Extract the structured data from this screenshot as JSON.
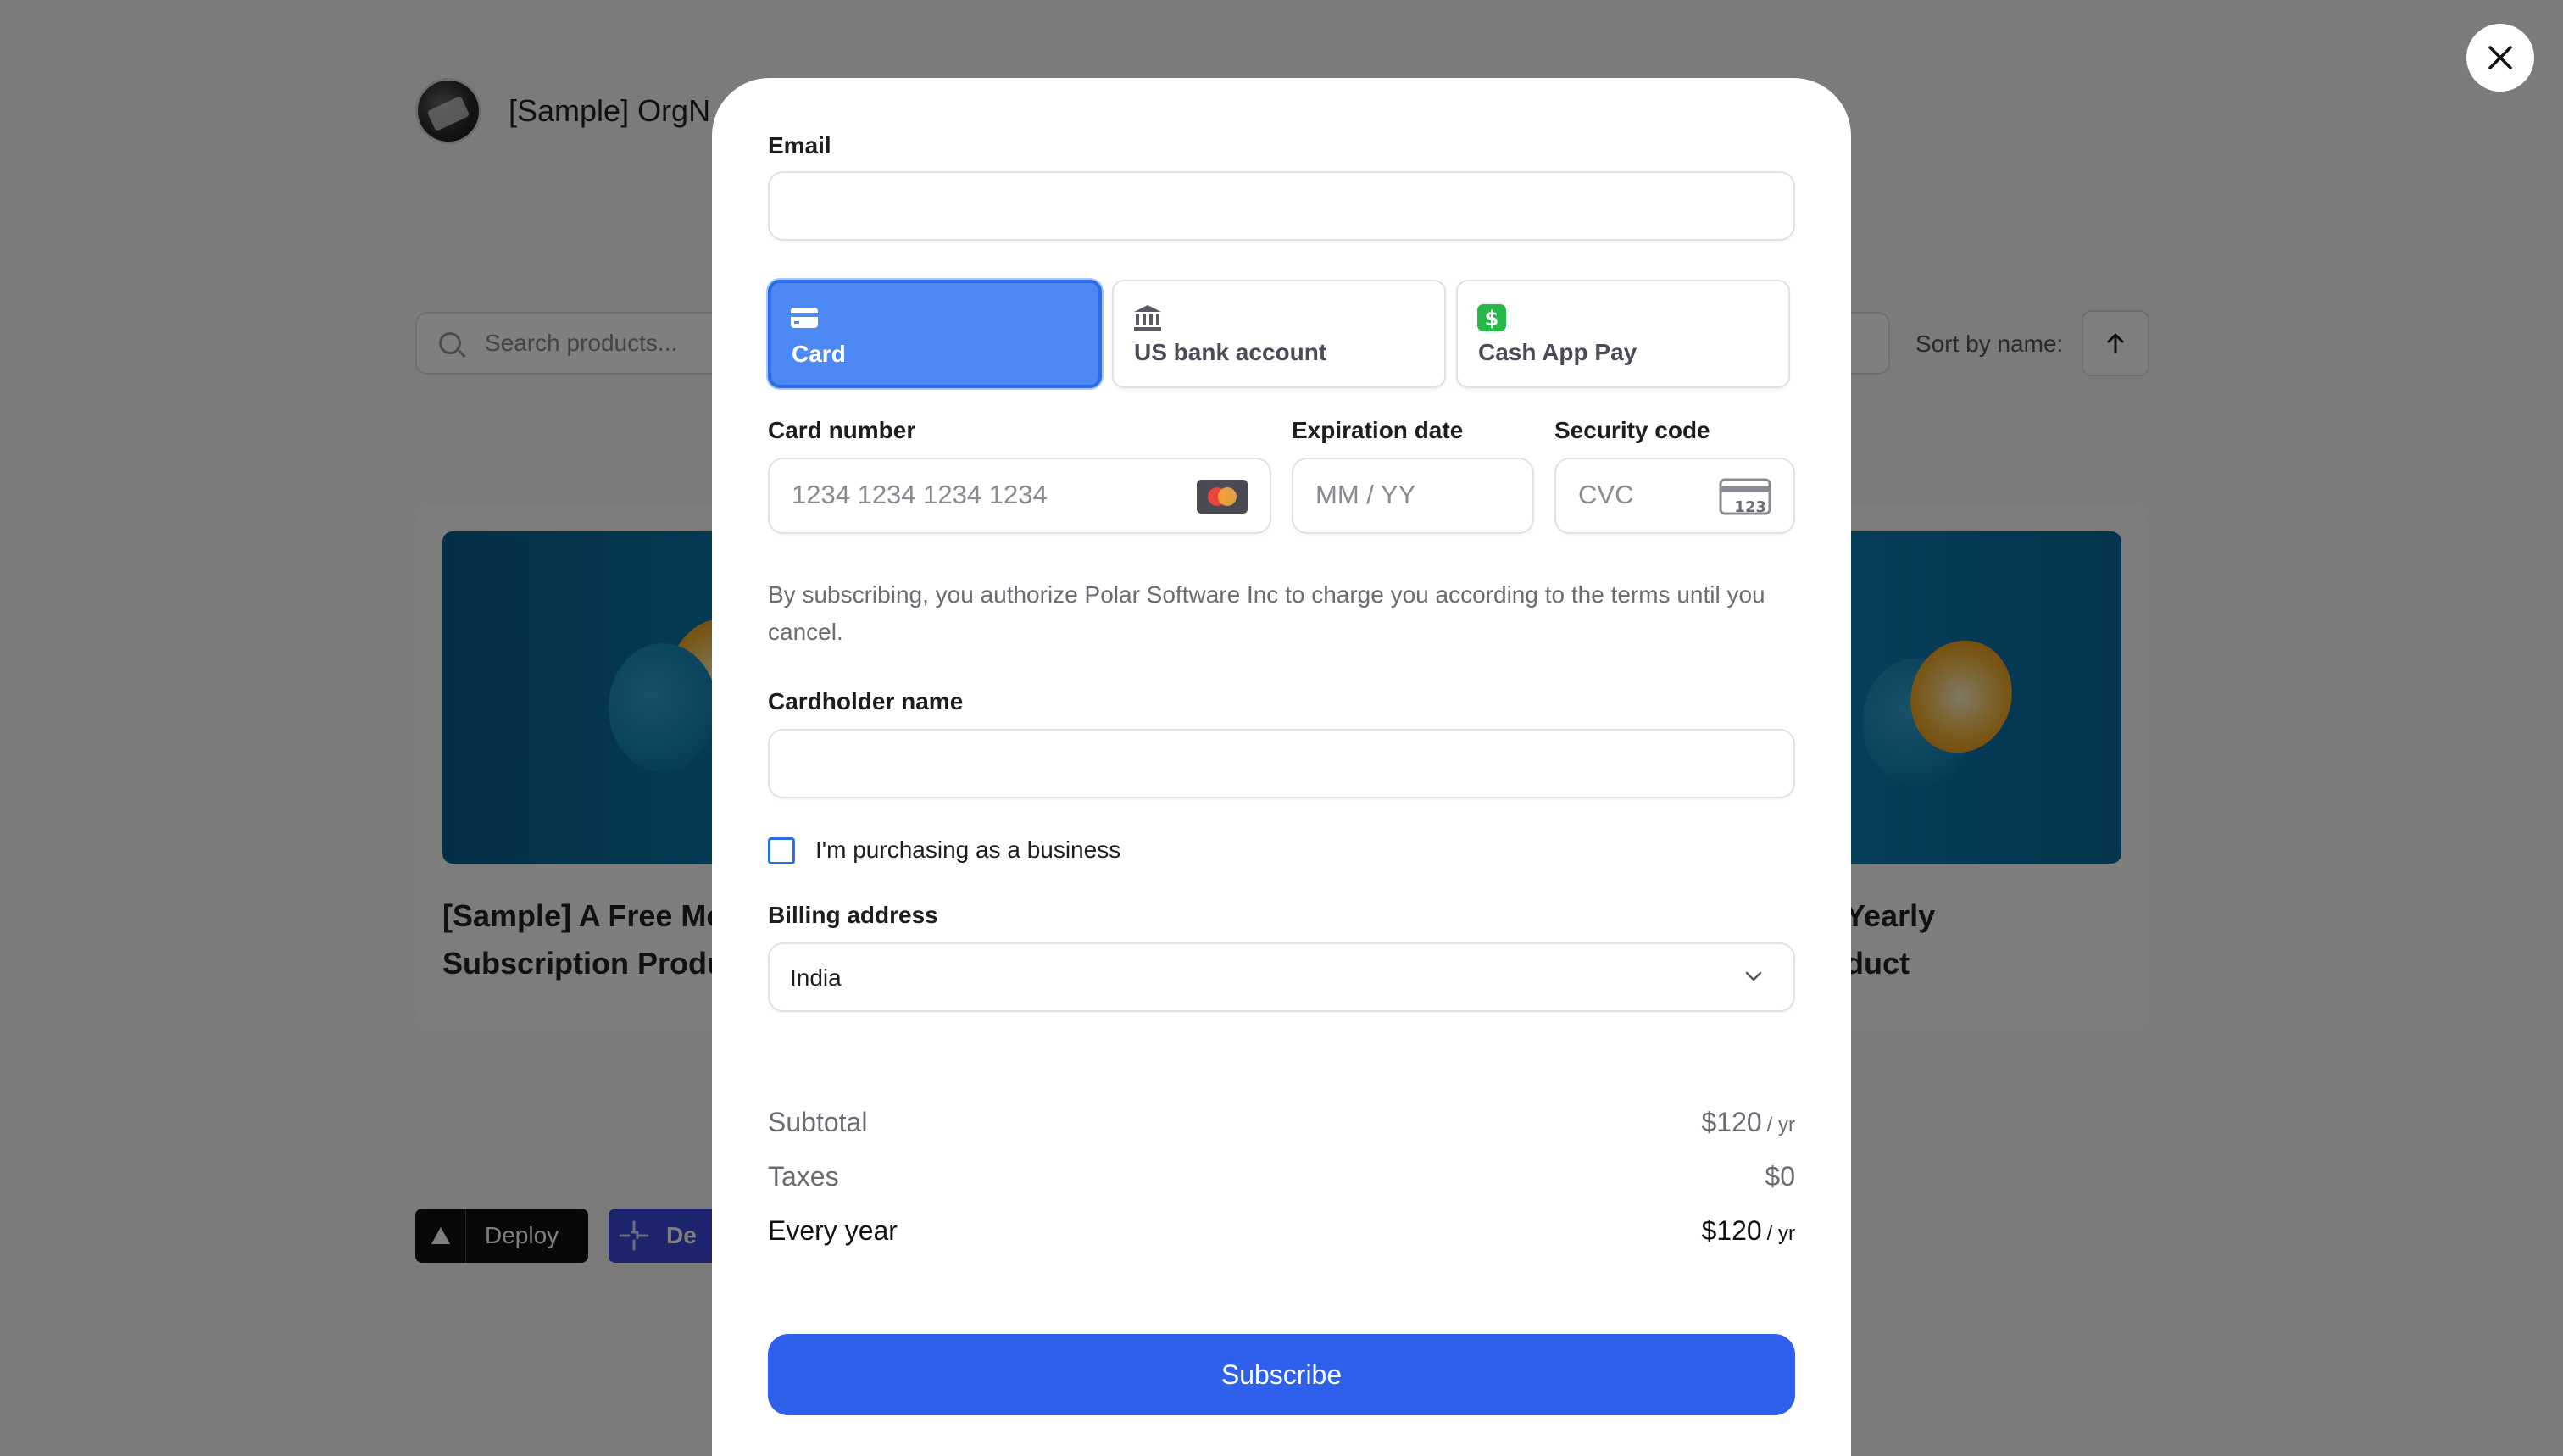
{
  "background": {
    "org_name": "[Sample] OrgN",
    "search_placeholder": "Search products...",
    "sort_label": "Sort by name:",
    "products": [
      {
        "title": "[Sample] A Free Mo\nSubscription Produ"
      },
      {
        "title": "Yearly\nduct"
      }
    ],
    "deploy_label": "Deploy",
    "deploy2_label": "De"
  },
  "modal": {
    "email_label": "Email",
    "payment_methods": [
      {
        "label": "Card",
        "icon": "credit-card-icon",
        "active": true
      },
      {
        "label": "US bank account",
        "icon": "bank-icon",
        "active": false
      },
      {
        "label": "Cash App Pay",
        "icon": "cash-app-icon",
        "active": false
      }
    ],
    "card_number": {
      "label": "Card number",
      "placeholder": "1234 1234 1234 1234"
    },
    "expiration": {
      "label": "Expiration date",
      "placeholder": "MM / YY"
    },
    "security": {
      "label": "Security code",
      "placeholder": "CVC",
      "icon_text": "123"
    },
    "terms": "By subscribing, you authorize Polar Software Inc to charge you according to the terms until you cancel.",
    "cardholder_label": "Cardholder name",
    "business_checkbox_label": "I'm purchasing as a business",
    "billing_label": "Billing address",
    "billing_country": "India",
    "summary": {
      "subtotal_label": "Subtotal",
      "subtotal_value": "$120",
      "subtotal_unit": "/ yr",
      "taxes_label": "Taxes",
      "taxes_value": "$0",
      "total_label": "Every year",
      "total_value": "$120",
      "total_unit": "/ yr"
    },
    "subscribe_label": "Subscribe"
  },
  "colors": {
    "accent": "#2f60eb",
    "active_tab": "#4c89f5",
    "cash_app": "#27b84a",
    "overlay": "rgba(0,0,0,0.5)"
  }
}
